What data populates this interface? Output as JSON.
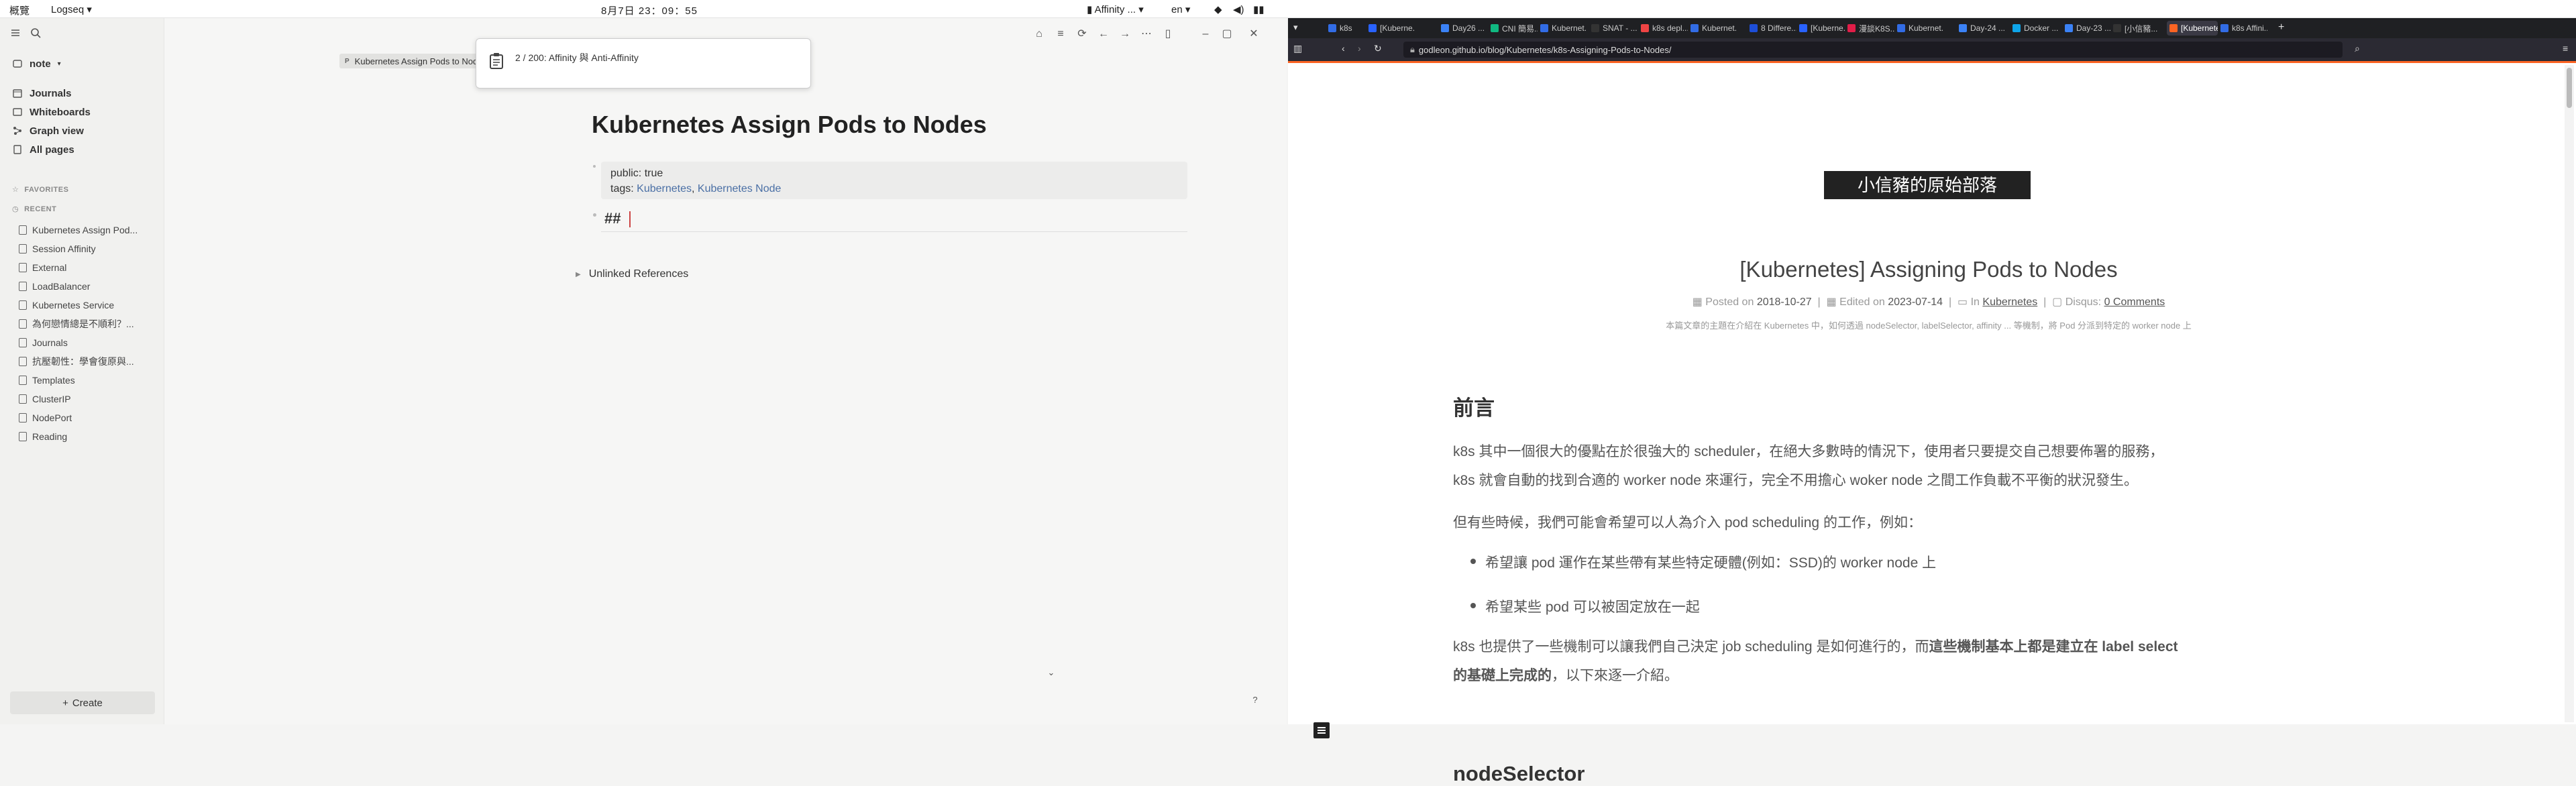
{
  "sysbar": {
    "activities": "概覽",
    "app": "Logseq",
    "clock": "8月7日  23：09：55",
    "affinity": "Affinity ...",
    "lang": "en"
  },
  "logseq": {
    "workspace": "note",
    "nav": [
      {
        "label": "Journals",
        "icon": "calendar-icon"
      },
      {
        "label": "Whiteboards",
        "icon": "whiteboard-icon"
      },
      {
        "label": "Graph view",
        "icon": "graph-icon"
      },
      {
        "label": "All pages",
        "icon": "pages-icon"
      }
    ],
    "favorites_label": "FAVORITES",
    "recent_label": "RECENT",
    "recent": [
      "Kubernetes Assign Pod...",
      "Session Affinity",
      "External",
      "LoadBalancer",
      "Kubernetes Service",
      "為何戀情總是不順利？...",
      "Journals",
      "抗壓韌性：學會復原與...",
      "Templates",
      "ClusterIP",
      "NodePort",
      "Reading"
    ],
    "create_label": "Create",
    "tab_label": "Kubernetes Assign Pods to Nodes",
    "page_title": "Kubernetes Assign Pods to Nodes",
    "props": {
      "public_key": "public:",
      "public_val": "true",
      "tags_key": "tags:",
      "tag1": "Kubernetes",
      "sep": ",",
      "tag2": "Kubernetes Node"
    },
    "heading": "##",
    "unlinked": "Unlinked References",
    "search_popup": "2 / 200: Affinity 與 Anti-Affinity",
    "help": "?"
  },
  "browser": {
    "tabs": [
      {
        "label": "k8s",
        "color": "#326ce5"
      },
      {
        "label": "[Kuberne...",
        "color": "#2962ff"
      },
      {
        "label": "Day26 ...",
        "color": "#3b82f6"
      },
      {
        "label": "CNI 簡易...",
        "color": "#10b981"
      },
      {
        "label": "Kubernet...",
        "color": "#326ce5"
      },
      {
        "label": "SNAT - ...",
        "color": "#333"
      },
      {
        "label": "k8s depl...",
        "color": "#ef4444"
      },
      {
        "label": "Kubernet...",
        "color": "#326ce5"
      },
      {
        "label": "8 Differe...",
        "color": "#1d4ed8"
      },
      {
        "label": "[Kuberne...",
        "color": "#2962ff"
      },
      {
        "label": "漫談K8S...",
        "color": "#e11d48"
      },
      {
        "label": "Kubernet...",
        "color": "#326ce5"
      },
      {
        "label": "Day-24 ...",
        "color": "#3b82f6"
      },
      {
        "label": "Docker ...",
        "color": "#0ea5e9"
      },
      {
        "label": "Day-23 ...",
        "color": "#3b82f6"
      },
      {
        "label": "[小信豬...",
        "color": "#333"
      },
      {
        "label": "[Kubernetes",
        "color": "#fc6423"
      },
      {
        "label": "k8s Affini...",
        "color": "#326ce5"
      }
    ],
    "url": "godleon.github.io/blog/Kubernetes/k8s-Assigning-Pods-to-Nodes/",
    "brand": "小信豬的原始部落",
    "post_title": "[Kubernetes] Assigning Pods to Nodes",
    "meta": {
      "posted_label": "Posted on",
      "posted": "2018-10-27",
      "edited_label": "Edited on",
      "edited": "2023-07-14",
      "in_label": "In",
      "category": "Kubernetes",
      "disqus_label": "Disqus:",
      "comments": "0 Comments"
    },
    "description": "本篇文章的主題在介紹在 Kubernetes 中，如何透過 nodeSelector, labelSelector, affinity ... 等機制，將 Pod 分派到特定的 worker node 上",
    "h_intro": "前言",
    "p1": "k8s 其中一個很大的優點在於很強大的 scheduler，在絕大多數時的情況下，使用者只要提交自己想要佈署的服務，k8s 就會自動的找到合適的 worker node 來運行，完全不用擔心 woker node 之間工作負載不平衡的狀況發生。",
    "p2": "但有些時候，我們可能會希望可以人為介入 pod scheduling 的工作，例如：",
    "li1": "希望讓 pod 運作在某些帶有某些特定硬體(例如：SSD)的 worker node 上",
    "li2": "希望某些 pod 可以被固定放在一起",
    "p3a": "k8s 也提供了一些機制可以讓我們自己決定 job scheduling 是如何進行的，而",
    "p3b": "這些機制基本上都是建立在 label select 的基礎上完成的",
    "p3c": "，以下來逐一介紹。",
    "h_next": "nodeSelector"
  }
}
